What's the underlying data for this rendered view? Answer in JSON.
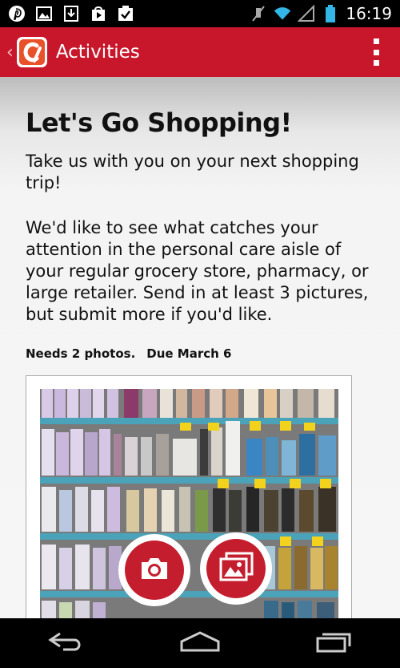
{
  "status_bar": {
    "time": "16:19",
    "left_icons": [
      "pinterest-icon",
      "image-icon",
      "download-icon",
      "play-store-icon",
      "task-icon"
    ],
    "right_icons": [
      "mute-icon",
      "wifi-icon",
      "signal-icon",
      "battery-icon"
    ]
  },
  "action_bar": {
    "title": "Activities",
    "brand_color": "#c8162a"
  },
  "activity": {
    "title": "Let's Go Shopping!",
    "intro": "Take us with you on your next shopping trip!",
    "description": "We'd like to see what catches your attention in the personal care aisle of your regular grocery store, pharmacy, or large retailer. Send in at least 3 pictures, but submit more if you'd like.",
    "needs": "Needs 2 photos.",
    "due": "Due March 6"
  },
  "photo_actions": {
    "camera_icon": "camera-icon",
    "gallery_icon": "gallery-icon",
    "accent": "#c41e2e"
  },
  "nav_bar": {
    "icons": [
      "back-icon",
      "home-icon",
      "recent-apps-icon"
    ]
  }
}
